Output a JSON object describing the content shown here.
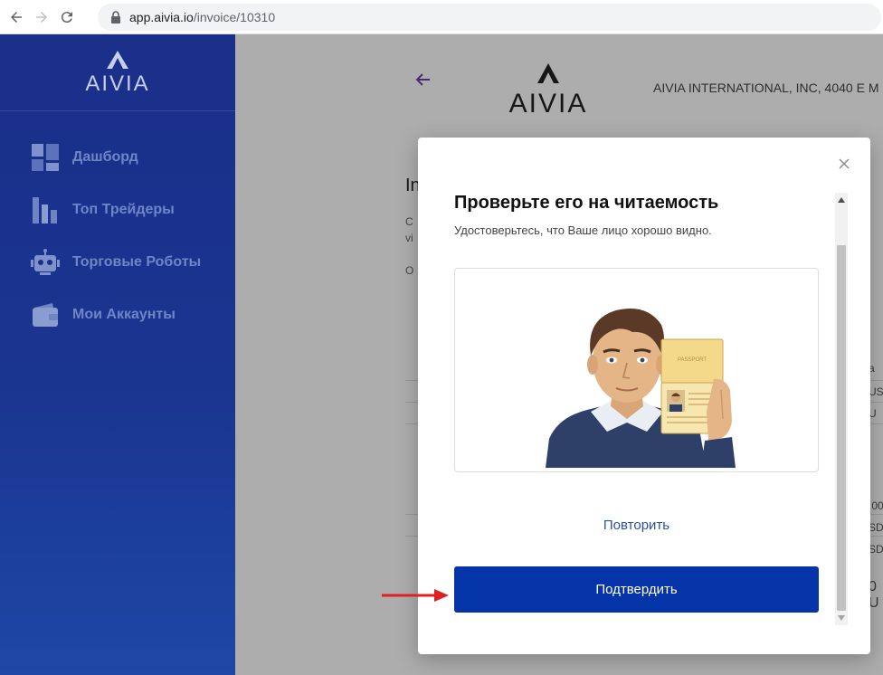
{
  "browser": {
    "url_host": "app.aivia.io",
    "url_path": "/invoice/10310"
  },
  "sidebar": {
    "logo_text": "AIVIA",
    "items": [
      {
        "label": "Дашборд",
        "icon": "dashboard-icon"
      },
      {
        "label": "Топ Трейдеры",
        "icon": "bar-chart-icon"
      },
      {
        "label": "Торговые Роботы",
        "icon": "robot-icon"
      },
      {
        "label": "Мои Аккаунты",
        "icon": "wallet-icon"
      }
    ]
  },
  "page": {
    "logo_text": "AIVIA",
    "company": "AIVIA INTERNATIONAL, INC, 4040 E M",
    "title_partial": "In",
    "text_partial_1": "C",
    "text_partial_2": "vi",
    "text_partial_3": "O",
    "cells": [
      "a",
      "USI",
      "U",
      ".00",
      "SD",
      "SD",
      "0 U"
    ]
  },
  "modal": {
    "title": "Проверьте его на читаемость",
    "subtitle": "Удостоверьтесь, что Ваше лицо хорошо видно.",
    "passport_label": "PASSPORT",
    "retry_label": "Повторить",
    "confirm_label": "Подтвердить"
  },
  "colors": {
    "sidebar_bg": "#1a2f8a",
    "primary_button": "#0533a8",
    "link": "#2c4ea8",
    "annotation_arrow": "#e02020"
  }
}
